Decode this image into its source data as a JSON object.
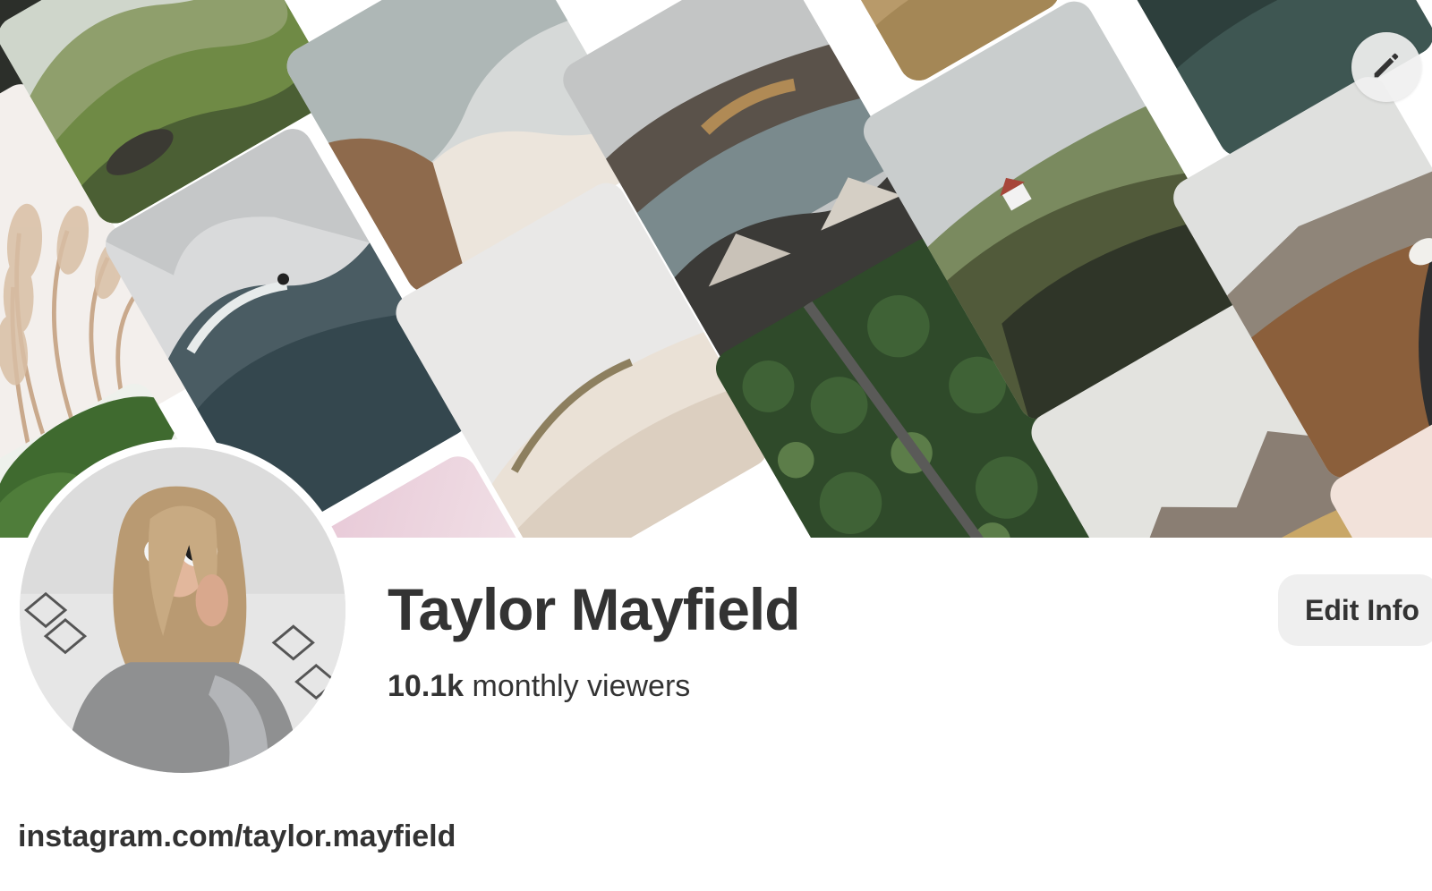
{
  "profile": {
    "name": "Taylor Mayfield",
    "viewers_count": "10.1k",
    "viewers_label": "monthly viewers",
    "edit_info_label": "Edit Info",
    "website": "instagram.com/taylor.mayfield"
  },
  "cover": {
    "edit_icon": "pencil-icon"
  },
  "colors": {
    "text": "#333333",
    "button_bg": "#efefef",
    "background": "#ffffff"
  }
}
